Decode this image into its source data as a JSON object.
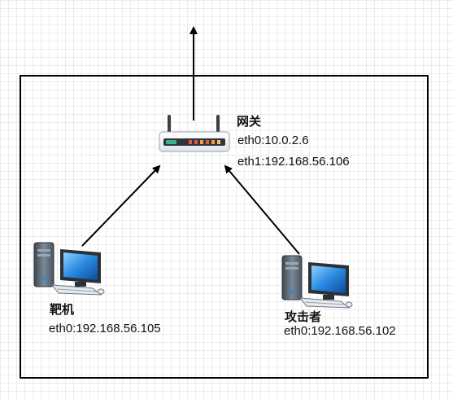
{
  "gateway": {
    "title": "网关",
    "eth0": "eth0:10.0.2.6",
    "eth1": "eth1:192.168.56.106",
    "icon": "router-icon"
  },
  "target": {
    "title": "靶机",
    "eth0": "eth0:192.168.56.105",
    "icon": "desktop-computer-icon"
  },
  "attacker": {
    "title": "攻击者",
    "eth0": "eth0:192.168.56.102",
    "icon": "desktop-computer-icon"
  },
  "colors": {
    "line": "#000000",
    "grid": "#ececec",
    "router_body": "#ffffff",
    "router_accent": "#3fae8c",
    "router_led_red": "#e05a3c",
    "router_led_orange": "#f0a040",
    "monitor_screen": "#1f7fd0",
    "tower": "#5f6b7a"
  }
}
